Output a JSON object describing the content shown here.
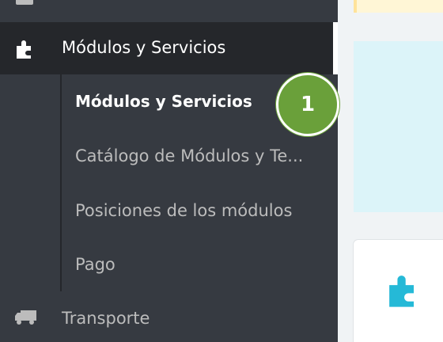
{
  "sidebar": {
    "parent": {
      "label": "Módulos y Servicios",
      "icon": "puzzle-icon"
    },
    "submenu": [
      {
        "label": "Módulos y Servicios",
        "active": true
      },
      {
        "label": "Catálogo de Módulos y Te...",
        "active": false
      },
      {
        "label": "Posiciones de los módulos",
        "active": false
      },
      {
        "label": "Pago",
        "active": false
      }
    ],
    "next": {
      "label": "Transporte",
      "icon": "truck-icon"
    }
  },
  "badge": {
    "number": "1",
    "color": "#6aa03a"
  },
  "content": {
    "panel_icon": "puzzle-icon",
    "accent": "#25b9d7"
  }
}
